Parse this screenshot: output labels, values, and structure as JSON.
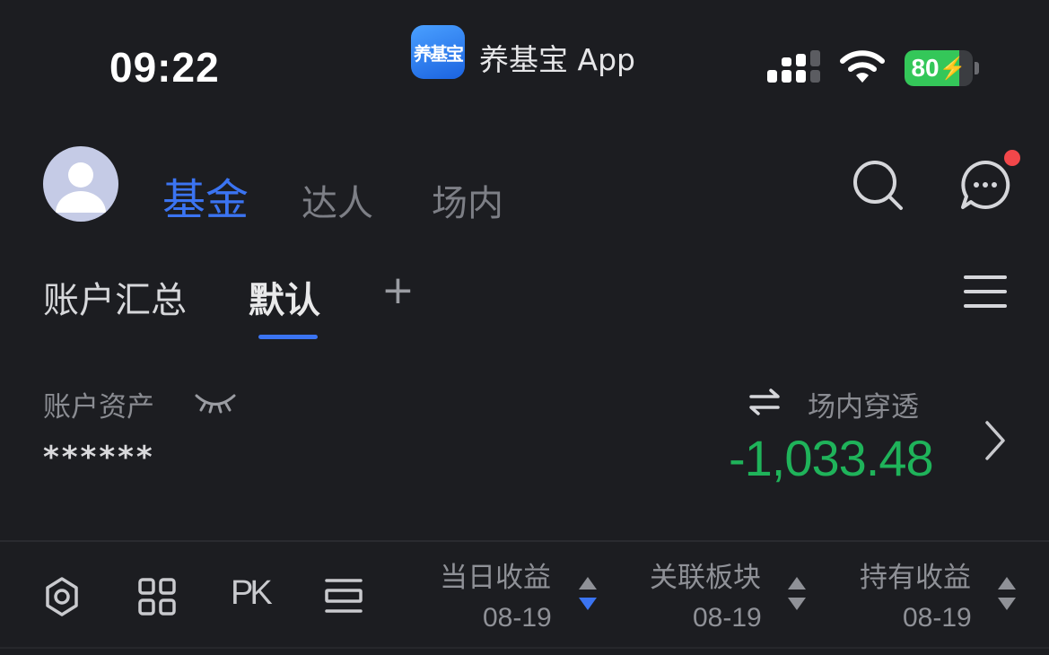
{
  "status_bar": {
    "time": "09:22",
    "app_name": "养基宝 App",
    "app_logo_text": "养基宝",
    "battery": "80",
    "battery_level_percent": 80
  },
  "header": {
    "tabs": [
      {
        "label": "基金",
        "active": true
      },
      {
        "label": "达人",
        "active": false
      },
      {
        "label": "场内",
        "active": false
      }
    ],
    "has_unread_message": true
  },
  "sub_tabs": {
    "items": [
      {
        "label": "账户汇总",
        "active": false
      },
      {
        "label": "默认",
        "active": true
      }
    ],
    "add_label": "+"
  },
  "account": {
    "assets_label": "账户资产",
    "assets_value": "******",
    "exchange_label": "场内穿透",
    "profit_value": "-1,033.48"
  },
  "columns": [
    {
      "title": "当日收益",
      "date": "08-19",
      "sort": "desc"
    },
    {
      "title": "关联板块",
      "date": "08-19",
      "sort": "none"
    },
    {
      "title": "持有收益",
      "date": "08-19",
      "sort": "none"
    }
  ],
  "toolbar": {
    "pk_label": "PK"
  },
  "colors": {
    "accent": "#3b74f2",
    "profit_negative": "#1fb35a",
    "background": "#1c1d21",
    "badge": "#f2474a"
  }
}
